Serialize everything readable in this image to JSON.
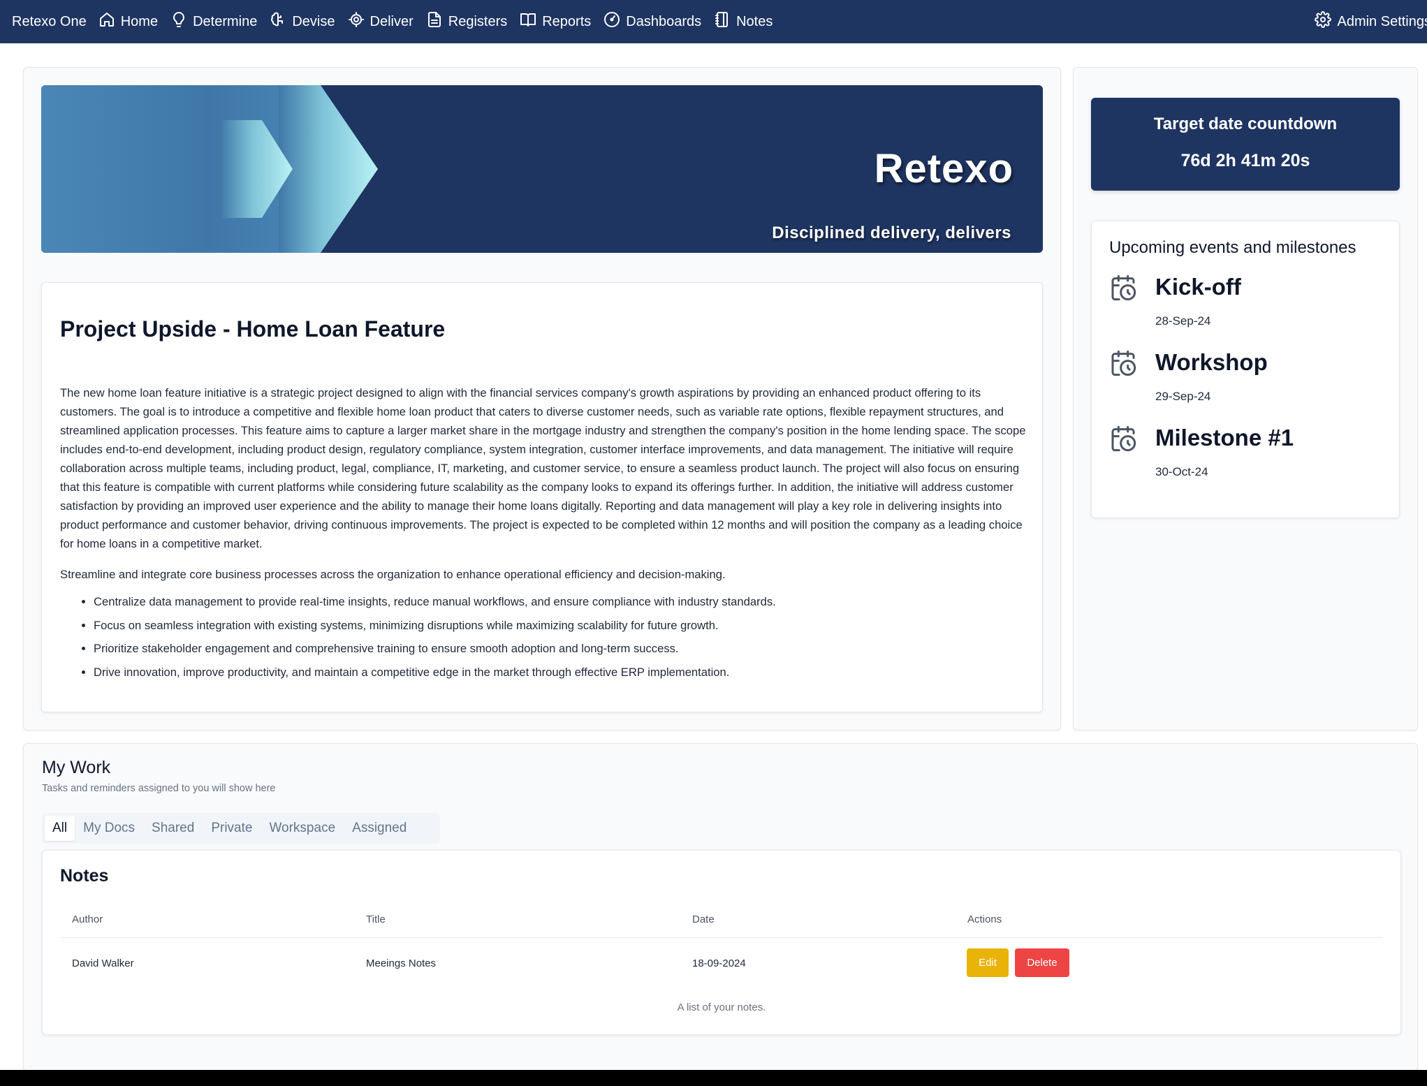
{
  "nav": {
    "brand": "Retexo One",
    "items": [
      {
        "label": "Home",
        "icon": "home-icon"
      },
      {
        "label": "Determine",
        "icon": "lightbulb-icon"
      },
      {
        "label": "Devise",
        "icon": "brain-icon"
      },
      {
        "label": "Deliver",
        "icon": "target-icon"
      },
      {
        "label": "Registers",
        "icon": "document-icon"
      },
      {
        "label": "Reports",
        "icon": "book-icon"
      },
      {
        "label": "Dashboards",
        "icon": "gauge-icon"
      },
      {
        "label": "Notes",
        "icon": "notebook-icon"
      }
    ],
    "admin": {
      "label": "Admin Settings",
      "icon": "gear-icon"
    }
  },
  "banner": {
    "title": "Retexo",
    "subtitle": "Disciplined delivery, delivers"
  },
  "project": {
    "title": "Project Upside - Home Loan Feature",
    "description": "The new home loan feature initiative is a strategic project designed to align with the financial services company's growth aspirations by providing an enhanced product offering to its customers. The goal is to introduce a competitive and flexible home loan product that caters to diverse customer needs, such as variable rate options, flexible repayment structures, and streamlined application processes. This feature aims to capture a larger market share in the mortgage industry and strengthen the company's position in the home lending space. The scope includes end-to-end development, including product design, regulatory compliance, system integration, customer interface improvements, and data management. The initiative will require collaboration across multiple teams, including product, legal, compliance, IT, marketing, and customer service, to ensure a seamless product launch. The project will also focus on ensuring that this feature is compatible with current platforms while considering future scalability as the company looks to expand its offerings further. In addition, the initiative will address customer satisfaction by providing an improved user experience and the ability to manage their home loans digitally. Reporting and data management will play a key role in delivering insights into product performance and customer behavior, driving continuous improvements. The project is expected to be completed within 12 months and will position the company as a leading choice for home loans in a competitive market.",
    "goal": "Streamline and integrate core business processes across the organization to enhance operational efficiency and decision-making.",
    "bullets": [
      "Centralize data management to provide real-time insights, reduce manual workflows, and ensure compliance with industry standards.",
      "Focus on seamless integration with existing systems, minimizing disruptions while maximizing scalability for future growth.",
      "Prioritize stakeholder engagement and comprehensive training to ensure smooth adoption and long-term success.",
      "Drive innovation, improve productivity, and maintain a competitive edge in the market through effective ERP implementation."
    ]
  },
  "countdown": {
    "label": "Target date countdown",
    "value": "76d 2h 41m 20s"
  },
  "events": {
    "title": "Upcoming events and milestones",
    "items": [
      {
        "name": "Kick-off",
        "date": "28-Sep-24",
        "icon": "calendar-clock-icon"
      },
      {
        "name": "Workshop",
        "date": "29-Sep-24",
        "icon": "calendar-clock-icon"
      },
      {
        "name": "Milestone #1",
        "date": "30-Oct-24",
        "icon": "calendar-clock-icon"
      }
    ]
  },
  "my_work": {
    "title": "My Work",
    "subtitle": "Tasks and reminders assigned to you will show here",
    "tabs": [
      "All",
      "My Docs",
      "Shared",
      "Private",
      "Workspace",
      "Assigned"
    ],
    "active_tab": "All"
  },
  "notes": {
    "title": "Notes",
    "columns": [
      "Author",
      "Title",
      "Date",
      "Actions"
    ],
    "rows": [
      {
        "author": "David Walker",
        "title": "Meeings Notes",
        "date": "18-09-2024",
        "edit": "Edit",
        "delete": "Delete"
      }
    ],
    "caption": "A list of your notes.",
    "colors": {
      "edit": "#eab308",
      "delete": "#ef4444"
    }
  },
  "theme": {
    "navy": "#1e3461"
  }
}
